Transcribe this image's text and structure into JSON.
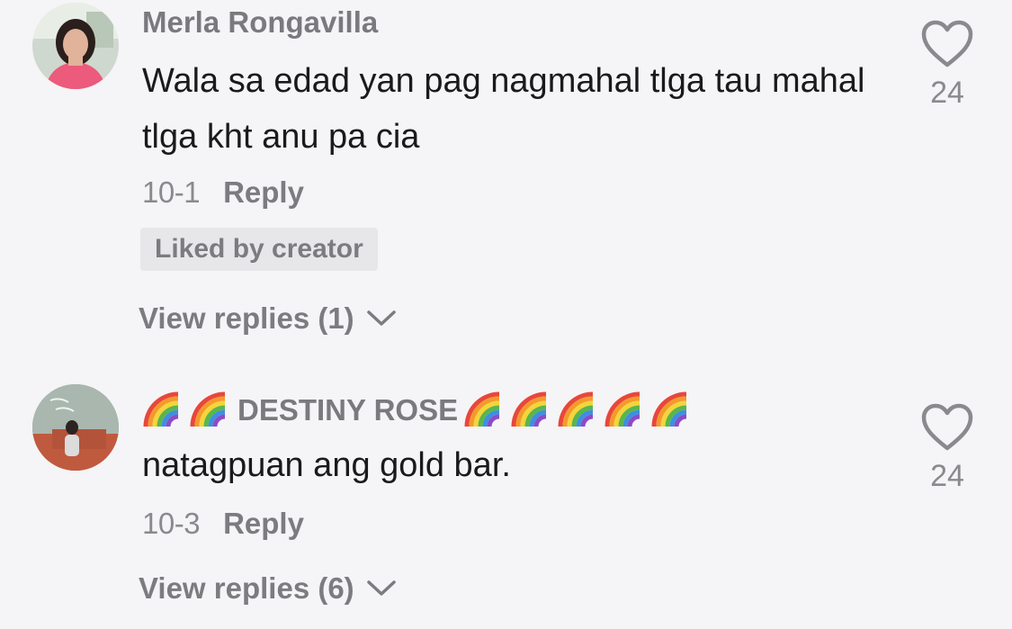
{
  "comments": [
    {
      "username": "Merla Rongavilla",
      "text": "Wala sa edad yan pag nagmahal tlga tau mahal tlga kht anu pa cia",
      "date": "10-1",
      "reply_label": "Reply",
      "badge": "Liked by creator",
      "view_replies": "View replies (1)",
      "likes": "24"
    },
    {
      "username_prefix_emoji": [
        "rainbow",
        "rainbow"
      ],
      "username": "DESTINY ROSE",
      "username_suffix_emoji": [
        "rainbow",
        "rainbow",
        "rainbow",
        "rainbow",
        "rainbow"
      ],
      "text": "natagpuan ang gold bar.",
      "date": "10-3",
      "reply_label": "Reply",
      "view_replies": "View replies (6)",
      "likes": "24"
    }
  ],
  "icons": {
    "like": "heart-outline-icon",
    "expand": "chevron-down-icon",
    "emoji": "rainbow-emoji"
  },
  "colors": {
    "background": "#f5f4f6",
    "text_primary": "#1a1a1c",
    "text_secondary": "#8a8a8e",
    "badge_bg": "#e7e6e9"
  }
}
